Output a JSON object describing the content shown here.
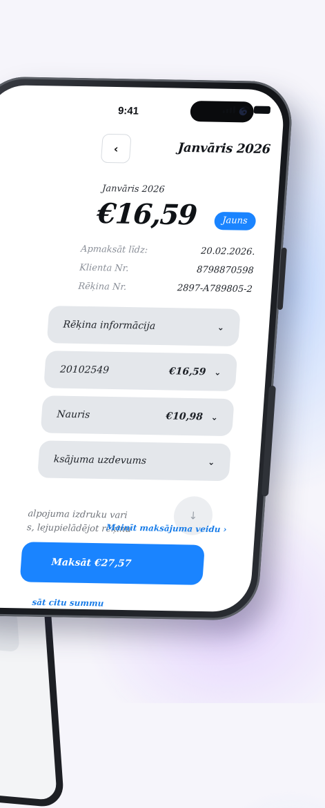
{
  "status_bar": {
    "time": "9:41"
  },
  "header": {
    "back_icon": "‹",
    "title": "Janvāris 2026"
  },
  "invoice": {
    "period": "Janvāris 2026",
    "amount": "€16,59",
    "badge": "Jauns",
    "meta": [
      {
        "label": "Apmaksāt līdz:",
        "value": "20.02.2026."
      },
      {
        "label": "Klienta Nr.",
        "value": "8798870598"
      },
      {
        "label": "Rēķina Nr.",
        "value": "2897-A789805-2"
      }
    ]
  },
  "sections": [
    {
      "label": "Rēķina informācija",
      "amount": ""
    },
    {
      "label": "20102549",
      "amount": "€16,59"
    },
    {
      "label": "Nauris",
      "amount": "€10,98"
    },
    {
      "label": "ksājuma uzdevums",
      "amount": ""
    }
  ],
  "note": {
    "line1": "alpojuma izdruku vari",
    "line2": "s, lejupielādējot rēķinu"
  },
  "download_icon": "↓",
  "change_method": "Mainīt maksājuma veidu ›",
  "pay_button": "Maksāt €27,57",
  "other_amount": "sāt citu summu",
  "colors": {
    "accent": "#1a84ff",
    "card": "#e4e7eb",
    "phone_frame": "#1d1f24"
  }
}
